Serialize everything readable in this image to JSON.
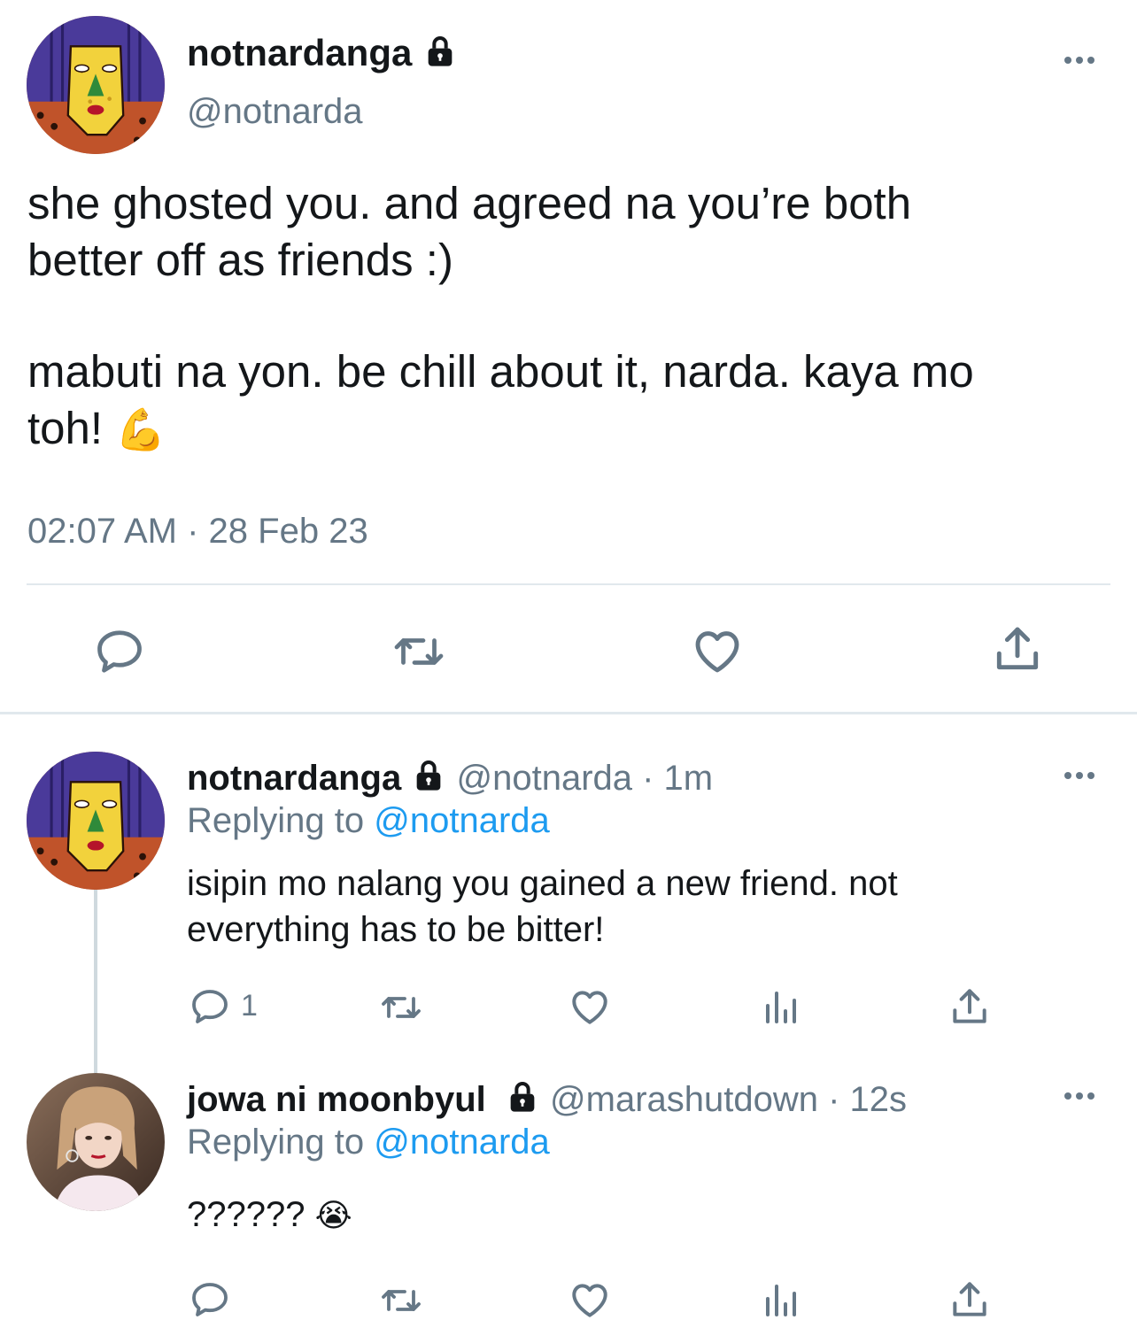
{
  "main_tweet": {
    "display_name": "notnardanga",
    "handle": "@notnarda",
    "text_line1": "she ghosted you. and agreed na you’re both",
    "text_line2": "better off as friends :)",
    "text_line3": "mabuti na yon. be chill about it, narda. kaya mo",
    "text_line4": "toh!",
    "emoji": "💪",
    "timestamp": "02:07 AM · 28 Feb 23"
  },
  "reply1": {
    "display_name": "notnardanga",
    "handle_time": "@notnarda · 1m",
    "replying_prefix": "Replying to",
    "replying_to": "@notnarda",
    "text_line1": "isipin mo nalang you gained a new friend. not",
    "text_line2": "everything has to be bitter!",
    "reply_count": "1"
  },
  "reply2": {
    "display_name": "jowa ni moonbyul",
    "handle_time": "@marashutdown · 12s",
    "replying_prefix": "Replying to",
    "replying_to": "@notnarda",
    "text": "??????",
    "emoji": "😭"
  },
  "icons": {
    "lock": "lock-icon",
    "more": "more-icon",
    "reply": "reply-icon",
    "retweet": "retweet-icon",
    "like": "heart-icon",
    "analytics": "analytics-icon",
    "share": "share-icon"
  },
  "colors": {
    "text": "#14171a",
    "secondary": "#657786",
    "link": "#1d9bf0",
    "divider": "#e1e8ed",
    "thread_line": "#cfd9de"
  }
}
